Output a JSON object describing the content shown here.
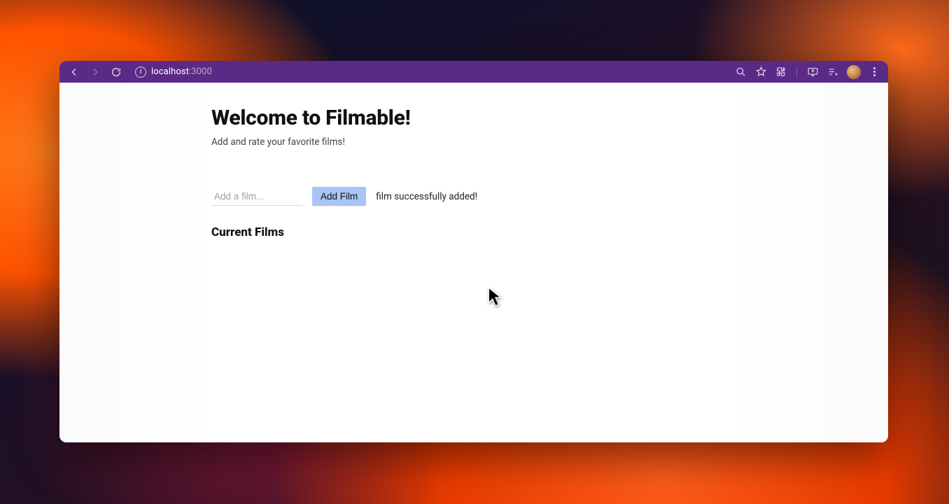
{
  "browser": {
    "url_host": "localhost",
    "url_port": ":3000",
    "icons": {
      "back": "back-icon",
      "forward": "forward-icon",
      "reload": "reload-icon",
      "info": "site-info-icon",
      "zoom": "zoom-icon",
      "bookmark": "star-icon",
      "extensions": "puzzle-icon",
      "screenshot": "screen-share-icon",
      "media": "media-control-icon",
      "profile": "avatar",
      "menu": "kebab-menu-icon"
    }
  },
  "page": {
    "title": "Welcome to Filmable!",
    "subtitle": "Add and rate your favorite films!",
    "input_placeholder": "Add a film...",
    "add_button_label": "Add Film",
    "status_message": "film successfully added!",
    "current_films_heading": "Current Films"
  },
  "colors": {
    "toolbar": "#5b2a86",
    "button_primary": "#a9c4f5"
  }
}
